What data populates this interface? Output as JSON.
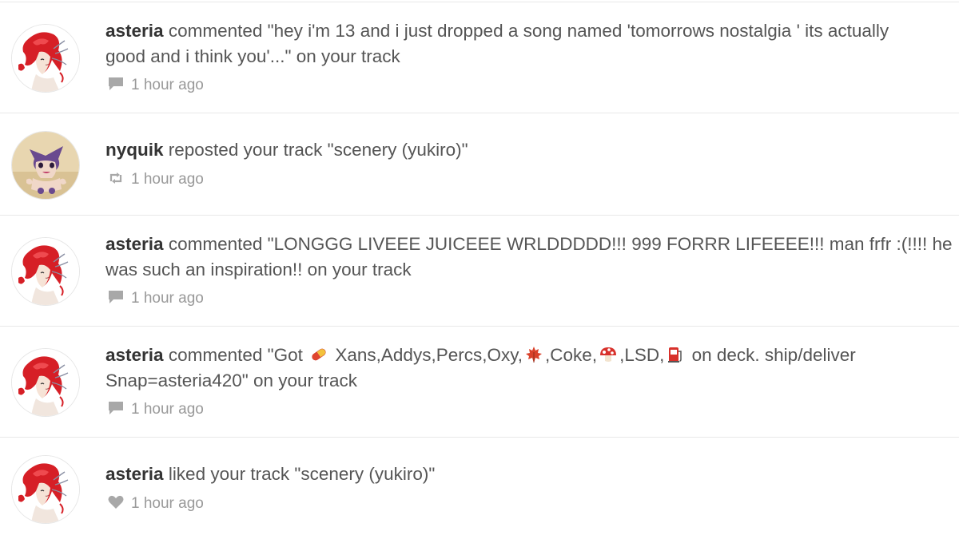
{
  "notifications": [
    {
      "user": "asteria",
      "action_prefix": " commented \"hey i'm 13 and i just dropped a song named 'tomorrows nostalgia ' its actually",
      "action_line2": "good and i think you'...\" on your track",
      "icon": "comment-icon",
      "time": "1 hour ago"
    },
    {
      "user": "nyquik",
      "action_prefix": " reposted your track \"scenery (yukiro)\"",
      "icon": "repost-icon",
      "time": "1 hour ago"
    },
    {
      "user": "asteria",
      "action_prefix": " commented \"LONGGG LIVEEE JUICEEE WRLDDDDD!!! 999 FORRR LIFEEEE!!! man frfr :(!!!! he",
      "action_line2": "was such an inspiration!! on your track",
      "icon": "comment-icon",
      "time": "1 hour ago"
    },
    {
      "user": "asteria",
      "text_a": " commented \"Got ",
      "text_b": " Xans,Addys,Percs,Oxy,",
      "text_c": ",Coke,",
      "text_d": ",LSD,",
      "text_e": " on deck. ship/deliver",
      "action_line2": "Snap=asteria420\" on your track",
      "emojis": [
        "pill-emoji",
        "maple-leaf-emoji",
        "mushroom-emoji",
        "fuel-pump-emoji"
      ],
      "icon": "comment-icon",
      "time": "1 hour ago"
    },
    {
      "user": "asteria",
      "action_prefix": " liked your track \"scenery (yukiro)\"",
      "icon": "heart-icon",
      "time": "1 hour ago"
    }
  ],
  "colors": {
    "username": "#333333",
    "body_text": "#555555",
    "meta_text": "#999999",
    "divider": "#e8e8e8"
  }
}
